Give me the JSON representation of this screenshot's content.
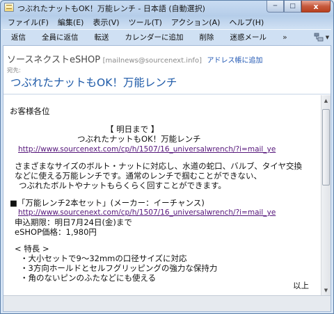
{
  "window": {
    "title": "つぶれたナットもOK！万能レンチ - 日本語 (自動選択)",
    "minimize": "─",
    "maximize": "□",
    "close": "x"
  },
  "menu": [
    "ファイル(F)",
    "編集(E)",
    "表示(V)",
    "ツール(T)",
    "アクション(A)",
    "ヘルプ(H)"
  ],
  "toolbar": {
    "buttons": [
      "返信",
      "全員に返信",
      "転送",
      "カレンダーに追加",
      "削除",
      "迷惑メール"
    ],
    "more": "»",
    "icons": [
      "rules-icon",
      "help-icon"
    ]
  },
  "header": {
    "from_name": "ソースネクストeSHOP",
    "from_address": "[mailnews@sourcenext.info]",
    "add_contact": "アドレス帳に追加",
    "to_label": "宛先:",
    "subject": "つぶれたナットもOK！万能レンチ"
  },
  "body": {
    "greeting": "お客様各位",
    "tag": "【 明日まで 】",
    "headline": "つぶれたナットもOK！万能レンチ",
    "url1": "http://www.sourcenext.com/cp/h/1507/16_universalwrench/?i=mail_ye",
    "para1": "さまざまなサイズのボルト・ナットに対応し、水道の蛇口、バルブ、タイヤ交換",
    "para2": "などに使える万能レンチです。通常のレンチで掴むことができない、",
    "para3": "つぶれたボルトやナットもらくらく回すことができます。",
    "product_line": "■「万能レンチ2本セット」(メーカー：イーチャンス)",
    "url2": "http://www.sourcenext.com/cp/h/1507/16_universalwrench/?i=mail_ye",
    "deadline": "申込期限：明日7月24日(金)まで",
    "price": "eSHOP価格：1,980円",
    "features_title": "< 特長 >",
    "features": [
      "・大小セットで9～32mmの口径サイズに対応",
      "・3方向ホールドとセルフグリッピングの強力な保持力",
      "・角のないピンのふたなどにも使える"
    ],
    "closing": "以上"
  }
}
